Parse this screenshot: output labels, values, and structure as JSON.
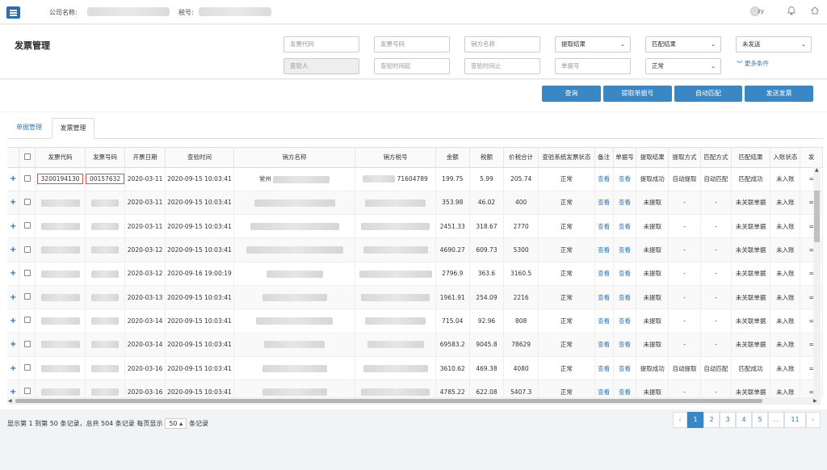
{
  "topbar": {
    "company_label": "公司名称:",
    "tax_label": "税号:",
    "user": "zy"
  },
  "header": {
    "title": "发票管理",
    "filters": {
      "invoice_code": "发票代码",
      "invoice_number": "发票号码",
      "seller_name": "销方名称",
      "extract_result": "提取结果",
      "match_result": "匹配结果",
      "send_status": "未发送",
      "inspector": "查验人",
      "check_time_from": "查验时间起",
      "check_time_to": "查验时间止",
      "document_no": "单据号",
      "normal": "正常"
    },
    "more_conditions": "更多条件"
  },
  "actions": {
    "query": "查询",
    "extract_doc_no": "提取单据号",
    "auto_match": "自动匹配",
    "send_invoice": "发送发票"
  },
  "tabs": {
    "doc_manage": "单据管理",
    "invoice_manage": "发票管理"
  },
  "table": {
    "headers": [
      "发票代码",
      "发票号码",
      "开票日期",
      "查验时间",
      "销方名称",
      "销方税号",
      "金额",
      "税额",
      "价税合计",
      "查验系统发票状态",
      "备注",
      "单据号",
      "提取结果",
      "提取方式",
      "匹配方式",
      "匹配结果",
      "入账状态",
      "发"
    ],
    "rows": [
      {
        "code": "3200194130",
        "number": "00157632",
        "date": "2020-03-11",
        "check_time": "2020-09-15 10:03:41",
        "seller_prefix": "常州",
        "tax_suffix": "71604789",
        "amount": "199.75",
        "tax": "5.99",
        "total": "205.74",
        "status": "正常",
        "remark": "查看",
        "doc": "查看",
        "extract": "提取成功",
        "extract_way": "自动提取",
        "match_way": "自动匹配",
        "match": "匹配成功",
        "account": "未入账",
        "extra": "="
      },
      {
        "code": "",
        "number": "",
        "date": "2020-03-11",
        "check_time": "2020-09-15 10:03:41",
        "seller_prefix": "",
        "tax_suffix": "",
        "amount": "353.98",
        "tax": "46.02",
        "total": "400",
        "status": "正常",
        "remark": "查看",
        "doc": "查看",
        "extract": "未提取",
        "extract_way": "-",
        "match_way": "-",
        "match": "未关联单据",
        "account": "未入账",
        "extra": "="
      },
      {
        "code": "",
        "number": "",
        "date": "2020-03-11",
        "check_time": "2020-09-15 10:03:41",
        "seller_prefix": "",
        "tax_suffix": "",
        "amount": "2451.33",
        "tax": "318.67",
        "total": "2770",
        "status": "正常",
        "remark": "查看",
        "doc": "查看",
        "extract": "未提取",
        "extract_way": "-",
        "match_way": "-",
        "match": "未关联单据",
        "account": "未入账",
        "extra": "="
      },
      {
        "code": "",
        "number": "",
        "date": "2020-03-12",
        "check_time": "2020-09-15 10:03:41",
        "seller_prefix": "",
        "tax_suffix": "",
        "amount": "4690.27",
        "tax": "609.73",
        "total": "5300",
        "status": "正常",
        "remark": "查看",
        "doc": "查看",
        "extract": "未提取",
        "extract_way": "-",
        "match_way": "-",
        "match": "未关联单据",
        "account": "未入账",
        "extra": "="
      },
      {
        "code": "",
        "number": "",
        "date": "2020-03-12",
        "check_time": "2020-09-16 19:00:19",
        "seller_prefix": "",
        "tax_suffix": "",
        "amount": "2796.9",
        "tax": "363.6",
        "total": "3160.5",
        "status": "正常",
        "remark": "查看",
        "doc": "查看",
        "extract": "未提取",
        "extract_way": "-",
        "match_way": "-",
        "match": "未关联单据",
        "account": "未入账",
        "extra": "="
      },
      {
        "code": "",
        "number": "",
        "date": "2020-03-13",
        "check_time": "2020-09-15 10:03:41",
        "seller_prefix": "",
        "tax_suffix": "",
        "amount": "1961.91",
        "tax": "254.09",
        "total": "2216",
        "status": "正常",
        "remark": "查看",
        "doc": "查看",
        "extract": "未提取",
        "extract_way": "-",
        "match_way": "-",
        "match": "未关联单据",
        "account": "未入账",
        "extra": "="
      },
      {
        "code": "",
        "number": "",
        "date": "2020-03-14",
        "check_time": "2020-09-15 10:03:41",
        "seller_prefix": "",
        "tax_suffix": "",
        "amount": "715.04",
        "tax": "92.96",
        "total": "808",
        "status": "正常",
        "remark": "查看",
        "doc": "查看",
        "extract": "未提取",
        "extract_way": "-",
        "match_way": "-",
        "match": "未关联单据",
        "account": "未入账",
        "extra": "="
      },
      {
        "code": "",
        "number": "",
        "date": "2020-03-14",
        "check_time": "2020-09-15 10:03:41",
        "seller_prefix": "",
        "tax_suffix": "",
        "amount": "69583.2",
        "tax": "9045.8",
        "total": "78629",
        "status": "正常",
        "remark": "查看",
        "doc": "查看",
        "extract": "未提取",
        "extract_way": "-",
        "match_way": "-",
        "match": "未关联单据",
        "account": "未入账",
        "extra": "="
      },
      {
        "code": "",
        "number": "",
        "date": "2020-03-16",
        "check_time": "2020-09-15 10:03:41",
        "seller_prefix": "",
        "tax_suffix": "",
        "amount": "3610.62",
        "tax": "469.38",
        "total": "4080",
        "status": "正常",
        "remark": "查看",
        "doc": "查看",
        "extract": "提取成功",
        "extract_way": "自动提取",
        "match_way": "自动匹配",
        "match": "匹配成功",
        "account": "未入账",
        "extra": "="
      },
      {
        "code": "",
        "number": "",
        "date": "2020-03-16",
        "check_time": "2020-09-15 10:03:41",
        "seller_prefix": "",
        "tax_suffix": "",
        "amount": "4785.22",
        "tax": "622.08",
        "total": "5407.3",
        "status": "正常",
        "remark": "查看",
        "doc": "查看",
        "extract": "未提取",
        "extract_way": "-",
        "match_way": "-",
        "match": "未关联单据",
        "account": "未入账",
        "extra": "="
      }
    ]
  },
  "pagination": {
    "info_prefix": "显示第 1 到第 50 条记录，总共 504 条记录 每页显示",
    "page_size": "50",
    "info_suffix": "条记录",
    "pages": [
      "‹",
      "1",
      "2",
      "3",
      "4",
      "5",
      "...",
      "11",
      "›"
    ],
    "current": "1"
  }
}
